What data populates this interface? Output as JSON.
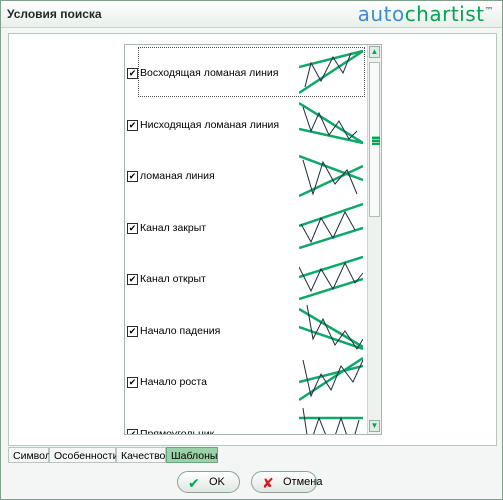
{
  "window": {
    "title": "Условия поиска"
  },
  "logo": {
    "part1": "auto",
    "part2": "chartist",
    "tm": "™"
  },
  "patterns": [
    {
      "label": "Восходящая ломаная линия",
      "checked": true,
      "icon": "ascending-wedge-icon"
    },
    {
      "label": "Нисходящая ломаная линия",
      "checked": true,
      "icon": "descending-wedge-icon"
    },
    {
      "label": "ломаная линия",
      "checked": true,
      "icon": "triangle-icon"
    },
    {
      "label": "Канал закрыт",
      "checked": true,
      "icon": "closed-channel-icon"
    },
    {
      "label": "Канал открыт",
      "checked": true,
      "icon": "open-channel-icon"
    },
    {
      "label": "Начало падения",
      "checked": true,
      "icon": "falling-start-icon"
    },
    {
      "label": "Начало роста",
      "checked": true,
      "icon": "rising-start-icon"
    },
    {
      "label": "Прямоугольник",
      "checked": true,
      "icon": "rectangle-icon"
    }
  ],
  "tabs": [
    {
      "label": "Символ"
    },
    {
      "label": "Особенности"
    },
    {
      "label": "Качество"
    },
    {
      "label": "Шаблоны",
      "active": true
    }
  ],
  "buttons": {
    "ok": "OK",
    "cancel": "Отмена"
  },
  "colors": {
    "accent": "#00a651",
    "pattern_line": "#0fa86a",
    "price_line": "#1e2d3d",
    "active_tab": "#9bd1a9"
  }
}
